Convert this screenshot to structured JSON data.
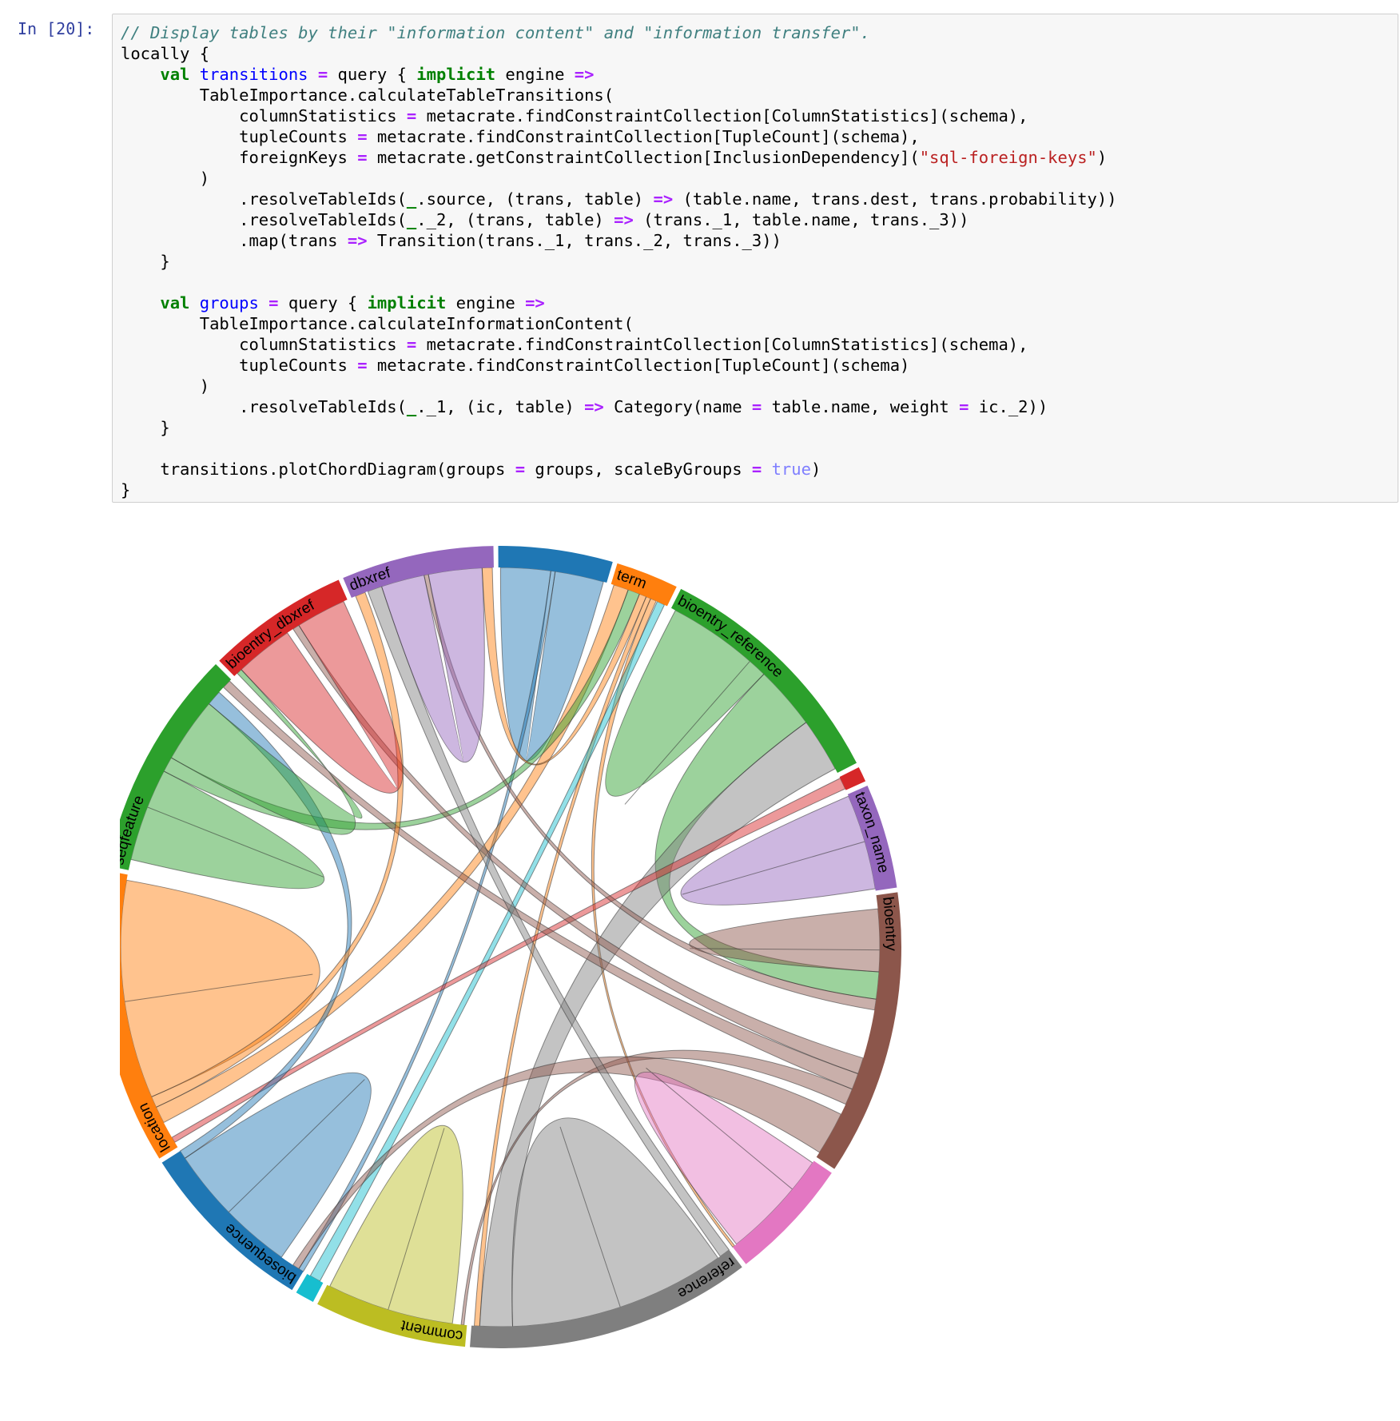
{
  "cell": {
    "prompt": "In [20]:",
    "code_lines": [
      [
        [
          "comment",
          "// Display tables by their \"information content\" and \"information transfer\"."
        ]
      ],
      [
        [
          "plain",
          "locally {"
        ]
      ],
      [
        [
          "plain",
          "    "
        ],
        [
          "kw",
          "val"
        ],
        [
          "plain",
          " "
        ],
        [
          "def",
          "transitions"
        ],
        [
          "plain",
          " "
        ],
        [
          "op",
          "="
        ],
        [
          "plain",
          " query { "
        ],
        [
          "kw",
          "implicit"
        ],
        [
          "plain",
          " engine "
        ],
        [
          "op",
          "=>"
        ]
      ],
      [
        [
          "plain",
          "        TableImportance.calculateTableTransitions("
        ]
      ],
      [
        [
          "plain",
          "            columnStatistics "
        ],
        [
          "op",
          "="
        ],
        [
          "plain",
          " metacrate.findConstraintCollection[ColumnStatistics](schema),"
        ]
      ],
      [
        [
          "plain",
          "            tupleCounts "
        ],
        [
          "op",
          "="
        ],
        [
          "plain",
          " metacrate.findConstraintCollection[TupleCount](schema),"
        ]
      ],
      [
        [
          "plain",
          "            foreignKeys "
        ],
        [
          "op",
          "="
        ],
        [
          "plain",
          " metacrate.getConstraintCollection[InclusionDependency]("
        ],
        [
          "str",
          "\"sql-foreign-keys\""
        ],
        [
          "plain",
          ")"
        ]
      ],
      [
        [
          "plain",
          "        )"
        ]
      ],
      [
        [
          "plain",
          "            .resolveTableIds("
        ],
        [
          "us",
          "_"
        ],
        [
          "plain",
          ".source, (trans, table) "
        ],
        [
          "op",
          "=>"
        ],
        [
          "plain",
          " (table.name, trans.dest, trans.probability))"
        ]
      ],
      [
        [
          "plain",
          "            .resolveTableIds("
        ],
        [
          "us",
          "_"
        ],
        [
          "plain",
          "._2, (trans, table) "
        ],
        [
          "op",
          "=>"
        ],
        [
          "plain",
          " (trans._1, table.name, trans._3))"
        ]
      ],
      [
        [
          "plain",
          "            .map(trans "
        ],
        [
          "op",
          "=>"
        ],
        [
          "plain",
          " Transition(trans._1, trans._2, trans._3))"
        ]
      ],
      [
        [
          "plain",
          "    }"
        ]
      ],
      [
        [
          "plain",
          ""
        ]
      ],
      [
        [
          "plain",
          "    "
        ],
        [
          "kw",
          "val"
        ],
        [
          "plain",
          " "
        ],
        [
          "def",
          "groups"
        ],
        [
          "plain",
          " "
        ],
        [
          "op",
          "="
        ],
        [
          "plain",
          " query { "
        ],
        [
          "kw",
          "implicit"
        ],
        [
          "plain",
          " engine "
        ],
        [
          "op",
          "=>"
        ]
      ],
      [
        [
          "plain",
          "        TableImportance.calculateInformationContent("
        ]
      ],
      [
        [
          "plain",
          "            columnStatistics "
        ],
        [
          "op",
          "="
        ],
        [
          "plain",
          " metacrate.findConstraintCollection[ColumnStatistics](schema),"
        ]
      ],
      [
        [
          "plain",
          "            tupleCounts "
        ],
        [
          "op",
          "="
        ],
        [
          "plain",
          " metacrate.findConstraintCollection[TupleCount](schema)"
        ]
      ],
      [
        [
          "plain",
          "        )"
        ]
      ],
      [
        [
          "plain",
          "            .resolveTableIds("
        ],
        [
          "us",
          "_"
        ],
        [
          "plain",
          "._1, (ic, table) "
        ],
        [
          "op",
          "=>"
        ],
        [
          "plain",
          " Category(name "
        ],
        [
          "op",
          "="
        ],
        [
          "plain",
          " table.name, weight "
        ],
        [
          "op",
          "="
        ],
        [
          "plain",
          " ic._2))"
        ]
      ],
      [
        [
          "plain",
          "    }"
        ]
      ],
      [
        [
          "plain",
          ""
        ]
      ],
      [
        [
          "plain",
          "    transitions.plotChordDiagram(groups "
        ],
        [
          "op",
          "="
        ],
        [
          "plain",
          " groups, scaleByGroups "
        ],
        [
          "op",
          "="
        ],
        [
          "plain",
          " "
        ],
        [
          "bool",
          "true"
        ],
        [
          "plain",
          ")"
        ]
      ],
      [
        [
          "plain",
          "}"
        ]
      ]
    ]
  },
  "chord": {
    "groups": [
      {
        "name": "",
        "color": "#1f77b4",
        "weight": 6.0
      },
      {
        "name": "term",
        "color": "#ff7f0e",
        "weight": 3.3
      },
      {
        "name": "bioentry_reference",
        "color": "#2ca02c",
        "weight": 13.0
      },
      {
        "name": "",
        "color": "#d62728",
        "weight": 0.8
      },
      {
        "name": "taxon_name",
        "color": "#9467bd",
        "weight": 5.5
      },
      {
        "name": "bioentry",
        "color": "#8c564b",
        "weight": 15.0
      },
      {
        "name": "",
        "color": "#e377c2",
        "weight": 6.5
      },
      {
        "name": "reference",
        "color": "#7f7f7f",
        "weight": 15.0
      },
      {
        "name": "comment",
        "color": "#bcbd22",
        "weight": 8.0
      },
      {
        "name": "",
        "color": "#17becf",
        "weight": 1.0
      },
      {
        "name": "biosequence",
        "color": "#1f77b4",
        "weight": 9.5
      },
      {
        "name": "location",
        "color": "#ff7f0e",
        "weight": 15.5
      },
      {
        "name": "seqfeature",
        "color": "#2ca02c",
        "weight": 12.0
      },
      {
        "name": "bioentry_dbxref",
        "color": "#d62728",
        "weight": 7.5
      },
      {
        "name": "dbxref",
        "color": "#9467bd",
        "weight": 8.0
      }
    ],
    "chords": [
      {
        "source": 0,
        "target": 0,
        "s0": 0.02,
        "s1": 0.48,
        "t0": 0.52,
        "t1": 0.97,
        "color": "#1f77b4"
      },
      {
        "source": 0,
        "target": 10,
        "s0": 0.48,
        "s1": 0.52,
        "t0": 0.0,
        "t1": 0.03,
        "color": "#1f77b4"
      },
      {
        "source": 1,
        "target": 11,
        "s0": 0.05,
        "s1": 0.3,
        "t0": 0.1,
        "t1": 0.16,
        "color": "#ff7f0e"
      },
      {
        "source": 1,
        "target": 12,
        "s0": 0.3,
        "s1": 0.5,
        "t0": 0.48,
        "t1": 0.55,
        "color": "#2ca02c"
      },
      {
        "source": 1,
        "target": 14,
        "s0": 0.5,
        "s1": 0.62,
        "t0": 0.92,
        "t1": 0.99,
        "color": "#ff7f0e"
      },
      {
        "source": 1,
        "target": 7,
        "s0": 0.62,
        "s1": 0.7,
        "t0": 0.97,
        "t1": 0.99,
        "color": "#ff7f0e"
      },
      {
        "source": 1,
        "target": 6,
        "s0": 0.7,
        "s1": 0.8,
        "t0": 0.98,
        "t1": 1.0,
        "color": "#ff7f0e"
      },
      {
        "source": 1,
        "target": 9,
        "s0": 0.82,
        "s1": 0.95,
        "t0": 0.2,
        "t1": 0.8,
        "color": "#17becf"
      },
      {
        "source": 2,
        "target": 2,
        "s0": 0.02,
        "s1": 0.4,
        "t0": 0.4,
        "t1": 0.48,
        "color": "#2ca02c"
      },
      {
        "source": 2,
        "target": 5,
        "s0": 0.48,
        "s1": 0.75,
        "t0": 0.28,
        "t1": 0.38,
        "color": "#2ca02c"
      },
      {
        "source": 2,
        "target": 7,
        "s0": 0.75,
        "s1": 0.98,
        "t0": 0.85,
        "t1": 0.97,
        "color": "#7f7f7f"
      },
      {
        "source": 3,
        "target": 11,
        "s0": 0.1,
        "s1": 0.9,
        "t0": 0.02,
        "t1": 0.04,
        "color": "#d62728"
      },
      {
        "source": 4,
        "target": 4,
        "s0": 0.02,
        "s1": 0.5,
        "t0": 0.5,
        "t1": 0.98,
        "color": "#9467bd"
      },
      {
        "source": 5,
        "target": 5,
        "s0": 0.05,
        "s1": 0.2,
        "t0": 0.2,
        "t1": 0.28,
        "color": "#8c564b"
      },
      {
        "source": 5,
        "target": 14,
        "s0": 0.38,
        "s1": 0.42,
        "t0": 0.52,
        "t1": 0.55,
        "color": "#8c564b"
      },
      {
        "source": 5,
        "target": 13,
        "s0": 0.6,
        "s1": 0.66,
        "t0": 0.55,
        "t1": 0.6,
        "color": "#8c564b"
      },
      {
        "source": 5,
        "target": 12,
        "s0": 0.66,
        "s1": 0.72,
        "t0": 0.95,
        "t1": 0.99,
        "color": "#8c564b"
      },
      {
        "source": 5,
        "target": 8,
        "s0": 0.72,
        "s1": 0.78,
        "t0": 0.02,
        "t1": 0.04,
        "color": "#8c564b"
      },
      {
        "source": 5,
        "target": 10,
        "s0": 0.82,
        "s1": 0.98,
        "t0": 0.03,
        "t1": 0.07,
        "color": "#8c564b"
      },
      {
        "source": 6,
        "target": 6,
        "s0": 0.02,
        "s1": 0.3,
        "t0": 0.3,
        "t1": 0.96,
        "color": "#e377c2"
      },
      {
        "source": 7,
        "target": 7,
        "s0": 0.05,
        "s1": 0.45,
        "t0": 0.45,
        "t1": 0.85,
        "color": "#7f7f7f"
      },
      {
        "source": 7,
        "target": 14,
        "s0": 0.0,
        "s1": 0.04,
        "t0": 0.12,
        "t1": 0.22,
        "color": "#7f7f7f"
      },
      {
        "source": 8,
        "target": 8,
        "s0": 0.1,
        "s1": 0.55,
        "t0": 0.55,
        "t1": 0.98,
        "color": "#bcbd22"
      },
      {
        "source": 10,
        "target": 10,
        "s0": 0.15,
        "s1": 0.55,
        "t0": 0.55,
        "t1": 0.95,
        "color": "#1f77b4"
      },
      {
        "source": 10,
        "target": 12,
        "s0": 0.95,
        "s1": 1.0,
        "t0": 0.85,
        "t1": 0.92,
        "color": "#1f77b4"
      },
      {
        "source": 11,
        "target": 11,
        "s0": 0.2,
        "s1": 0.55,
        "t0": 0.55,
        "t1": 0.98,
        "color": "#ff7f0e"
      },
      {
        "source": 11,
        "target": 14,
        "s0": 0.16,
        "s1": 0.2,
        "t0": 0.03,
        "t1": 0.1,
        "color": "#ff7f0e"
      },
      {
        "source": 12,
        "target": 12,
        "s0": 0.05,
        "s1": 0.3,
        "t0": 0.3,
        "t1": 0.48,
        "color": "#2ca02c"
      },
      {
        "source": 12,
        "target": 13,
        "s0": 0.55,
        "s1": 0.85,
        "t0": 0.03,
        "t1": 0.07,
        "color": "#2ca02c"
      },
      {
        "source": 13,
        "target": 13,
        "s0": 0.07,
        "s1": 0.5,
        "t0": 0.6,
        "t1": 0.97,
        "color": "#d62728"
      },
      {
        "source": 14,
        "target": 14,
        "s0": 0.22,
        "s1": 0.52,
        "t0": 0.55,
        "t1": 0.92,
        "color": "#9467bd"
      }
    ]
  }
}
